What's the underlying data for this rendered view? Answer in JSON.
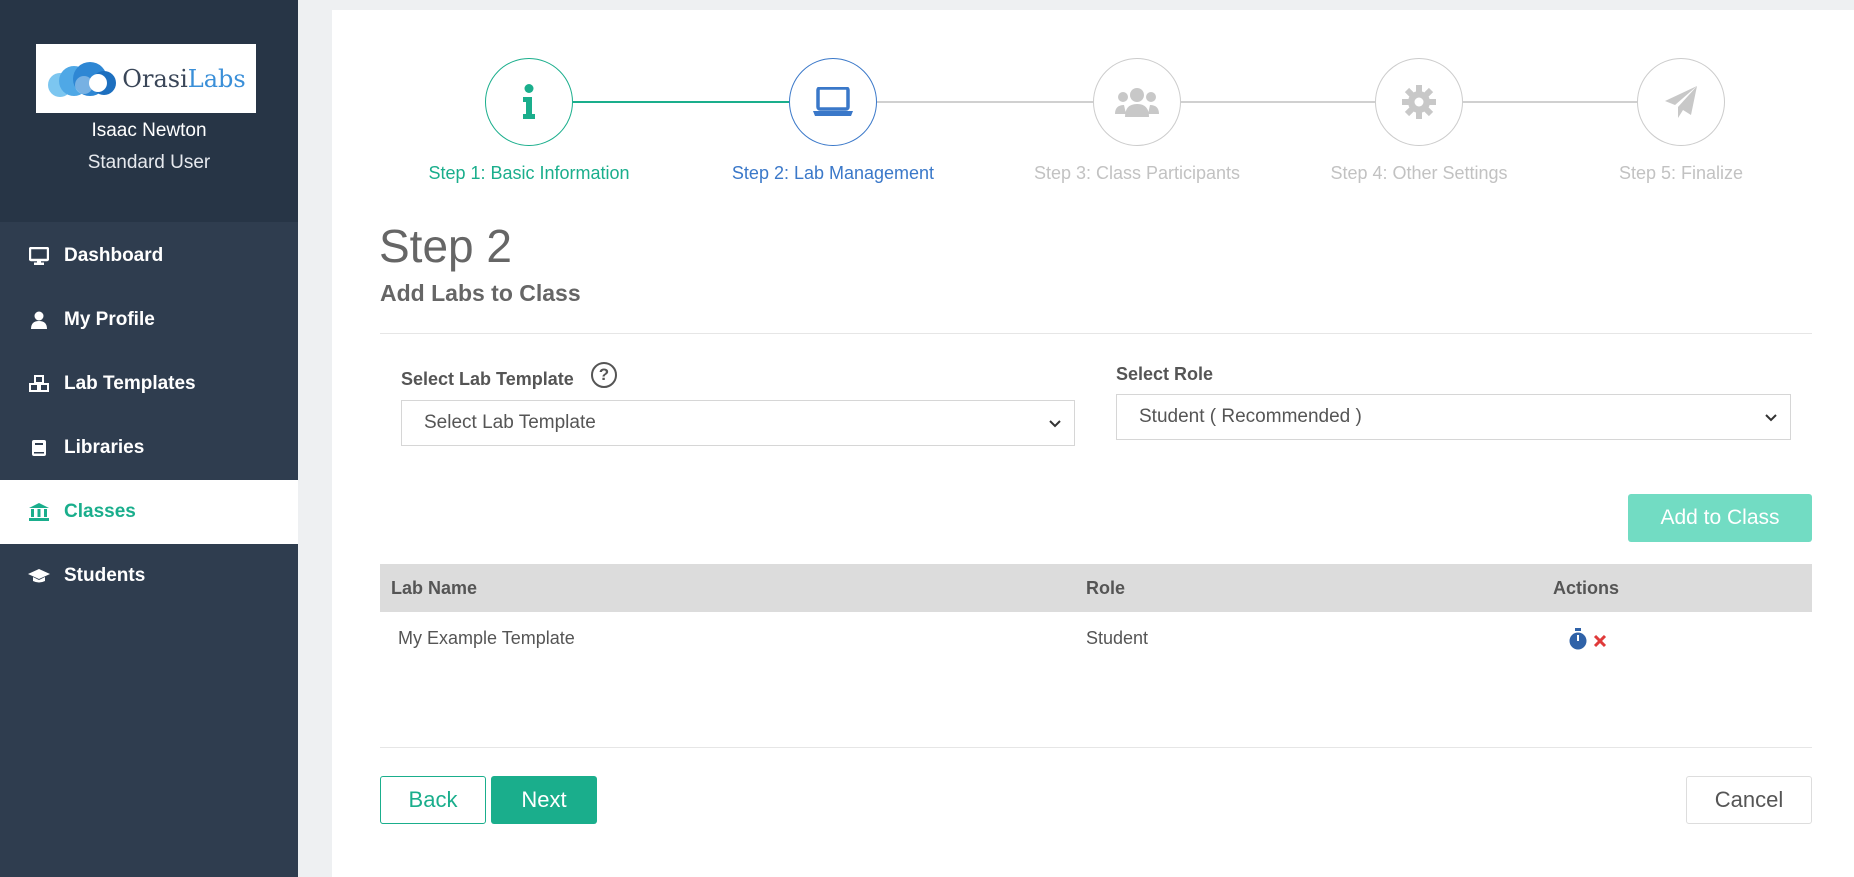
{
  "brand": {
    "name_part1": "Orasi",
    "name_part2": "Labs"
  },
  "user": {
    "name": "Isaac Newton",
    "role": "Standard User"
  },
  "sidebar": {
    "items": [
      {
        "label": "Dashboard",
        "icon": "monitor-icon"
      },
      {
        "label": "My Profile",
        "icon": "user-icon"
      },
      {
        "label": "Lab Templates",
        "icon": "cubes-icon"
      },
      {
        "label": "Libraries",
        "icon": "book-icon"
      },
      {
        "label": "Classes",
        "icon": "bank-icon",
        "active": true
      },
      {
        "label": "Students",
        "icon": "graduation-cap-icon"
      }
    ]
  },
  "stepper": {
    "steps": [
      {
        "label": "Step 1: Basic Information",
        "icon": "info-icon",
        "state": "complete"
      },
      {
        "label": "Step 2: Lab Management",
        "icon": "laptop-icon",
        "state": "current"
      },
      {
        "label": "Step 3: Class Participants",
        "icon": "users-icon",
        "state": "upcoming"
      },
      {
        "label": "Step 4: Other Settings",
        "icon": "gear-icon",
        "state": "upcoming"
      },
      {
        "label": "Step 5: Finalize",
        "icon": "paper-plane-icon",
        "state": "upcoming"
      }
    ]
  },
  "main": {
    "heading": "Step 2",
    "subheading": "Add Labs to Class",
    "lab_template": {
      "label": "Select Lab Template",
      "help": "?",
      "value": "Select Lab Template"
    },
    "role": {
      "label": "Select Role",
      "value": "Student ( Recommended )"
    },
    "add_button": "Add to Class",
    "table": {
      "columns": [
        "Lab Name",
        "Role",
        "Actions"
      ],
      "rows": [
        {
          "lab_name": "My Example Template",
          "role": "Student"
        }
      ]
    },
    "buttons": {
      "back": "Back",
      "next": "Next",
      "cancel": "Cancel"
    }
  },
  "colors": {
    "sidebar_bg": "#2f3d4f",
    "accent_green": "#1aae8c",
    "accent_blue": "#3a78c9",
    "add_button_bg": "#72dcc3",
    "delete_red": "#e03a3a"
  }
}
